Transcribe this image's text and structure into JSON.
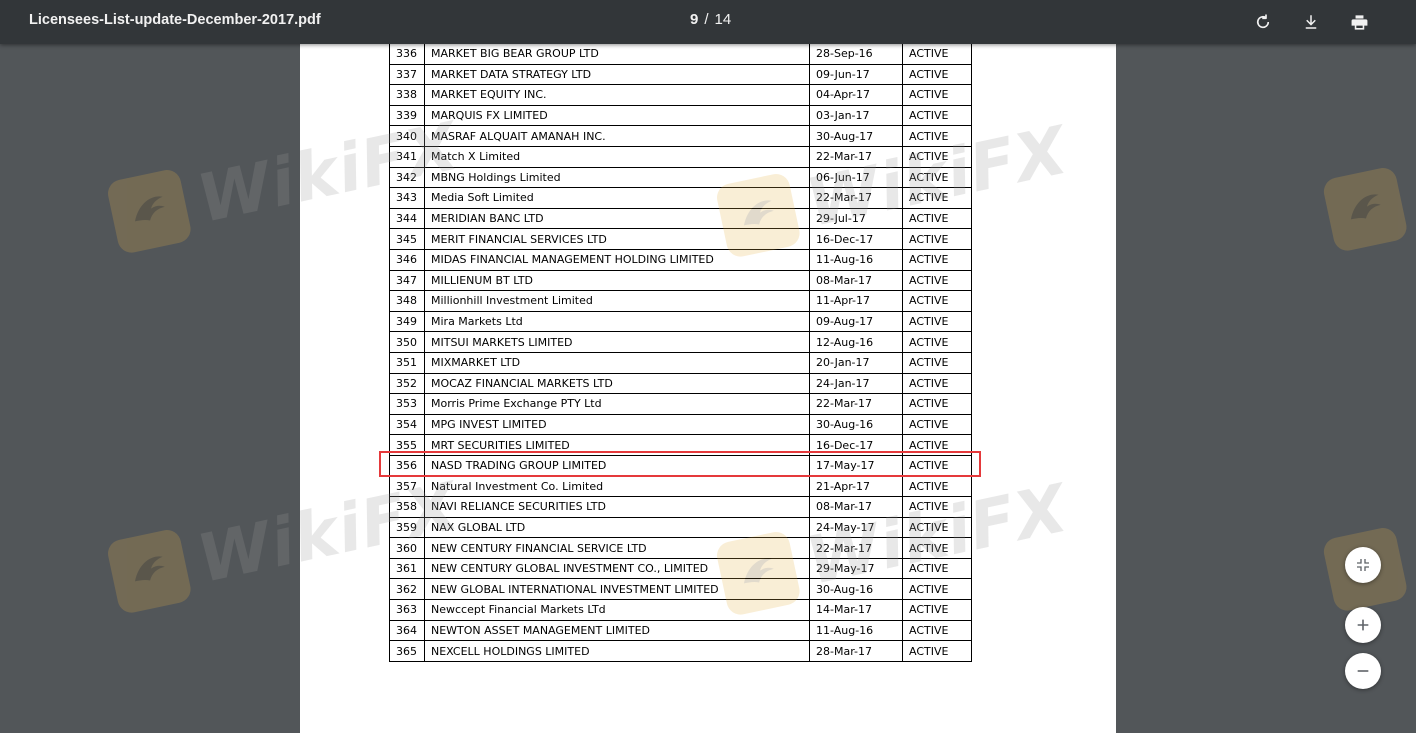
{
  "toolbar": {
    "file_name": "Licensees-List-update-December-2017.pdf",
    "current_page": "9",
    "separator": "/",
    "total_pages": "14",
    "rotate_icon": "rotate-icon",
    "download_icon": "download-icon",
    "print_icon": "print-icon"
  },
  "watermark": {
    "text": "WikiFX",
    "logo_color": "#e7b347"
  },
  "highlight_color": "#e5393b",
  "rows": [
    {
      "no": "336",
      "name": "MARKET BIG BEAR GROUP LTD",
      "date": "28-Sep-16",
      "status": "ACTIVE"
    },
    {
      "no": "337",
      "name": "MARKET DATA STRATEGY LTD",
      "date": "09-Jun-17",
      "status": "ACTIVE"
    },
    {
      "no": "338",
      "name": "MARKET EQUITY INC.",
      "date": "04-Apr-17",
      "status": "ACTIVE"
    },
    {
      "no": "339",
      "name": "MARQUIS FX LIMITED",
      "date": "03-Jan-17",
      "status": "ACTIVE"
    },
    {
      "no": "340",
      "name": "MASRAF ALQUAIT AMANAH INC.",
      "date": "30-Aug-17",
      "status": "ACTIVE"
    },
    {
      "no": "341",
      "name": "Match X Limited",
      "date": "22-Mar-17",
      "status": "ACTIVE"
    },
    {
      "no": "342",
      "name": "MBNG Holdings Limited",
      "date": "06-Jun-17",
      "status": "ACTIVE"
    },
    {
      "no": "343",
      "name": "Media Soft Limited",
      "date": "22-Mar-17",
      "status": "ACTIVE"
    },
    {
      "no": "344",
      "name": "MERIDIAN BANC LTD",
      "date": "29-Jul-17",
      "status": "ACTIVE"
    },
    {
      "no": "345",
      "name": "MERIT FINANCIAL SERVICES LTD",
      "date": "16-Dec-17",
      "status": "ACTIVE"
    },
    {
      "no": "346",
      "name": "MIDAS FINANCIAL MANAGEMENT HOLDING LIMITED",
      "date": "11-Aug-16",
      "status": "ACTIVE"
    },
    {
      "no": "347",
      "name": "MILLIENUM BT LTD",
      "date": "08-Mar-17",
      "status": "ACTIVE"
    },
    {
      "no": "348",
      "name": "Millionhill Investment Limited",
      "date": "11-Apr-17",
      "status": "ACTIVE"
    },
    {
      "no": "349",
      "name": "Mira Markets Ltd",
      "date": "09-Aug-17",
      "status": "ACTIVE"
    },
    {
      "no": "350",
      "name": "MITSUI MARKETS LIMITED",
      "date": "12-Aug-16",
      "status": "ACTIVE"
    },
    {
      "no": "351",
      "name": "MIXMARKET LTD",
      "date": "20-Jan-17",
      "status": "ACTIVE"
    },
    {
      "no": "352",
      "name": "MOCAZ FINANCIAL MARKETS LTD",
      "date": "24-Jan-17",
      "status": "ACTIVE"
    },
    {
      "no": "353",
      "name": "Morris Prime Exchange PTY Ltd",
      "date": "22-Mar-17",
      "status": "ACTIVE"
    },
    {
      "no": "354",
      "name": "MPG INVEST LIMITED",
      "date": "30-Aug-16",
      "status": "ACTIVE"
    },
    {
      "no": "355",
      "name": "MRT SECURITIES LIMITED",
      "date": "16-Dec-17",
      "status": "ACTIVE"
    },
    {
      "no": "356",
      "name": "NASD TRADING GROUP LIMITED",
      "date": "17-May-17",
      "status": "ACTIVE"
    },
    {
      "no": "357",
      "name": "Natural Investment Co. Limited",
      "date": "21-Apr-17",
      "status": "ACTIVE"
    },
    {
      "no": "358",
      "name": "NAVI RELIANCE SECURITIES LTD",
      "date": "08-Mar-17",
      "status": "ACTIVE"
    },
    {
      "no": "359",
      "name": "NAX GLOBAL LTD",
      "date": "24-May-17",
      "status": "ACTIVE"
    },
    {
      "no": "360",
      "name": "NEW CENTURY FINANCIAL SERVICE LTD",
      "date": "22-Mar-17",
      "status": "ACTIVE"
    },
    {
      "no": "361",
      "name": "NEW CENTURY GLOBAL INVESTMENT CO., LIMITED",
      "date": "29-May-17",
      "status": "ACTIVE"
    },
    {
      "no": "362",
      "name": "NEW GLOBAL INTERNATIONAL INVESTMENT LIMITED",
      "date": "30-Aug-16",
      "status": "ACTIVE"
    },
    {
      "no": "363",
      "name": "Newccept Financial Markets LTd",
      "date": "14-Mar-17",
      "status": "ACTIVE"
    },
    {
      "no": "364",
      "name": "NEWTON ASSET MANAGEMENT LIMITED",
      "date": "11-Aug-16",
      "status": "ACTIVE"
    },
    {
      "no": "365",
      "name": "NEXCELL HOLDINGS LIMITED",
      "date": "28-Mar-17",
      "status": "ACTIVE"
    }
  ],
  "zoom_controls": {
    "fit_icon": "fit-to-page-icon",
    "zoom_in_icon": "zoom-in-icon",
    "zoom_out_icon": "zoom-out-icon"
  }
}
